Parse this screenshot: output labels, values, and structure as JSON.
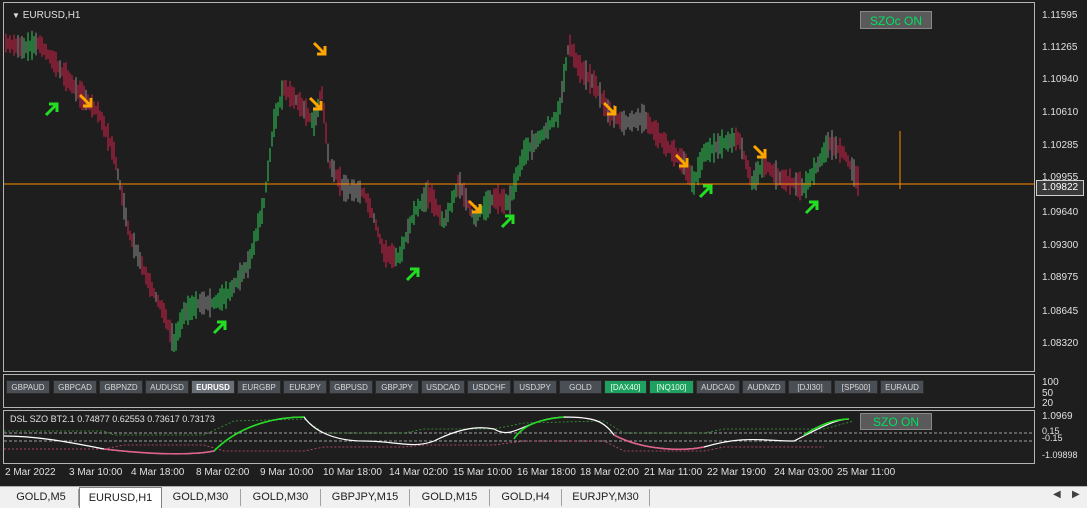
{
  "chart": {
    "title": "EURUSD,H1",
    "szoc_button": "SZOc ON",
    "current_price": "1.09822",
    "price_labels": [
      "1.11595",
      "1.11265",
      "1.10940",
      "1.10610",
      "1.10285",
      "1.09955",
      "1.09640",
      "1.09300",
      "1.08975",
      "1.08645",
      "1.08320"
    ],
    "colors": {
      "bull": "#2ecc55",
      "bear": "#d8204a",
      "neutral": "#909090",
      "price_line": "#ff8c00",
      "arrow_up": "#22dd22",
      "arrow_down": "#ffa500"
    }
  },
  "symbols": [
    {
      "label": "GBPAUD",
      "state": "normal"
    },
    {
      "label": "GBPCAD",
      "state": "normal"
    },
    {
      "label": "GBPNZD",
      "state": "normal"
    },
    {
      "label": "AUDUSD",
      "state": "normal"
    },
    {
      "label": "EURUSD",
      "state": "active"
    },
    {
      "label": "EURGBP",
      "state": "normal"
    },
    {
      "label": "EURJPY",
      "state": "normal"
    },
    {
      "label": "GBPUSD",
      "state": "normal"
    },
    {
      "label": "GBPJPY",
      "state": "normal"
    },
    {
      "label": "USDCAD",
      "state": "normal"
    },
    {
      "label": "USDCHF",
      "state": "normal"
    },
    {
      "label": "USDJPY",
      "state": "normal"
    },
    {
      "label": "GOLD",
      "state": "normal"
    },
    {
      "label": "[DAX40]",
      "state": "green"
    },
    {
      "label": "[NQ100]",
      "state": "green"
    },
    {
      "label": "AUDCAD",
      "state": "normal"
    },
    {
      "label": "AUDNZD",
      "state": "normal"
    },
    {
      "label": "[DJI30]",
      "state": "normal"
    },
    {
      "label": "[SP500]",
      "state": "normal"
    },
    {
      "label": "EURAUD",
      "state": "normal"
    }
  ],
  "sub_axis1": [
    "100",
    "50",
    "20"
  ],
  "indicator": {
    "title": "DSL SZO BT2.1 0.74877 0.62553 0.73617 0.73173",
    "szo_button": "SZO ON",
    "axis": [
      "1.0969",
      "0.15",
      "-0.15",
      "-1.09898"
    ]
  },
  "time_labels": [
    "2 Mar 2022",
    "3 Mar 10:00",
    "4 Mar 18:00",
    "8 Mar 02:00",
    "9 Mar 10:00",
    "10 Mar 18:00",
    "14 Mar 02:00",
    "15 Mar 10:00",
    "16 Mar 18:00",
    "18 Mar 02:00",
    "21 Mar 11:00",
    "22 Mar 19:00",
    "24 Mar 03:00",
    "25 Mar 11:00"
  ],
  "tabs": [
    {
      "label": "GOLD,M5",
      "active": false
    },
    {
      "label": "EURUSD,H1",
      "active": true
    },
    {
      "label": "GOLD,M30",
      "active": false
    },
    {
      "label": "GOLD,M30",
      "active": false
    },
    {
      "label": "GBPJPY,M15",
      "active": false
    },
    {
      "label": "GOLD,M15",
      "active": false
    },
    {
      "label": "GOLD,H4",
      "active": false
    },
    {
      "label": "EURJPY,M30",
      "active": false
    }
  ]
}
